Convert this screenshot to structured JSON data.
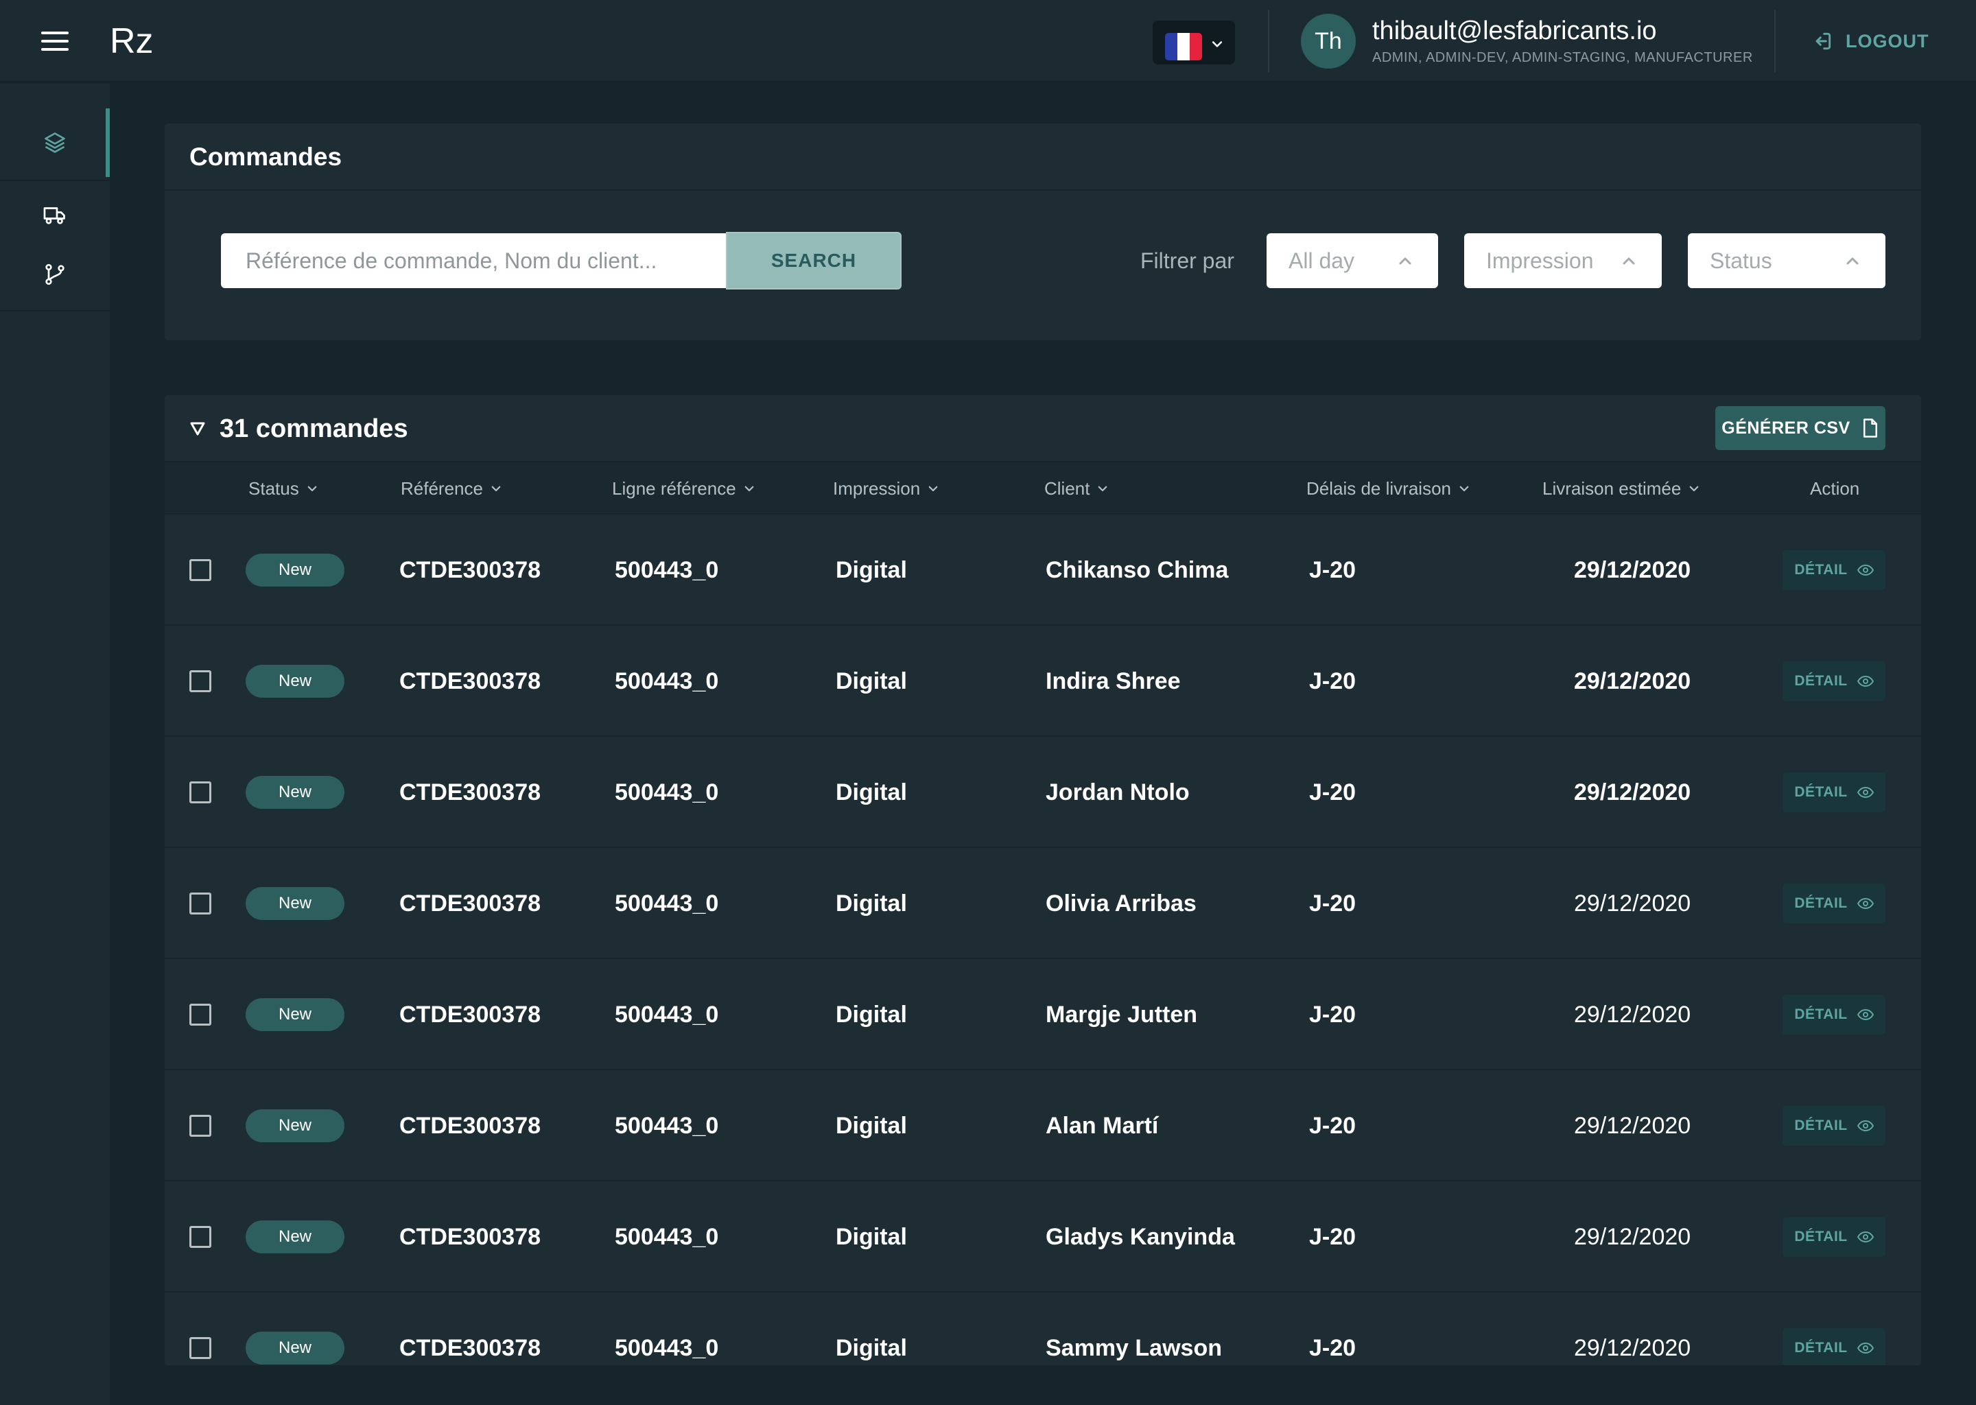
{
  "app": {
    "logo": "Rz"
  },
  "topbar": {
    "menu_icon": "hamburger-icon",
    "language": {
      "flag": "france-flag-icon",
      "chevron": "chevron-down-icon"
    },
    "user": {
      "initials": "Th",
      "email": "thibault@lesfabricants.io",
      "roles": "ADMIN, ADMIN-DEV, ADMIN-STAGING, MANUFACTURER"
    },
    "logout_label": "LOGOUT"
  },
  "sidebar": {
    "items": [
      {
        "icon": "layers-icon",
        "active": true
      },
      {
        "icon": "truck-icon",
        "active": false
      },
      {
        "icon": "git-branch-icon",
        "active": false
      }
    ]
  },
  "commandes": {
    "title": "Commandes",
    "search_placeholder": "Référence de commande, Nom du client...",
    "search_label": "SEARCH",
    "filter_label": "Filtrer par",
    "filters": [
      "All day",
      "Impression",
      "Status"
    ]
  },
  "list": {
    "count_label": "31 commandes",
    "csv_label": "GÉNÉRER CSV",
    "columns": {
      "status": "Status",
      "reference": "Référence",
      "line_reference": "Ligne référence",
      "impression": "Impression",
      "client": "Client",
      "delay": "Délais de livraison",
      "estimated": "Livraison estimée",
      "action": "Action"
    },
    "detail_label": "DÉTAIL",
    "rows": [
      {
        "status": "New",
        "reference": "CTDE300378",
        "line_reference": "500443_0",
        "impression": "Digital",
        "client": "Chikanso Chima",
        "delay": "J-20",
        "estimated": "29/12/2020",
        "estimated_bold": true
      },
      {
        "status": "New",
        "reference": "CTDE300378",
        "line_reference": "500443_0",
        "impression": "Digital",
        "client": "Indira Shree",
        "delay": "J-20",
        "estimated": "29/12/2020",
        "estimated_bold": true
      },
      {
        "status": "New",
        "reference": "CTDE300378",
        "line_reference": "500443_0",
        "impression": "Digital",
        "client": "Jordan Ntolo",
        "delay": "J-20",
        "estimated": "29/12/2020",
        "estimated_bold": true
      },
      {
        "status": "New",
        "reference": "CTDE300378",
        "line_reference": "500443_0",
        "impression": "Digital",
        "client": "Olivia Arribas",
        "delay": "J-20",
        "estimated": "29/12/2020",
        "estimated_bold": false
      },
      {
        "status": "New",
        "reference": "CTDE300378",
        "line_reference": "500443_0",
        "impression": "Digital",
        "client": "Margje Jutten",
        "delay": "J-20",
        "estimated": "29/12/2020",
        "estimated_bold": false
      },
      {
        "status": "New",
        "reference": "CTDE300378",
        "line_reference": "500443_0",
        "impression": "Digital",
        "client": "Alan Martí",
        "delay": "J-20",
        "estimated": "29/12/2020",
        "estimated_bold": false
      },
      {
        "status": "New",
        "reference": "CTDE300378",
        "line_reference": "500443_0",
        "impression": "Digital",
        "client": "Gladys Kanyinda",
        "delay": "J-20",
        "estimated": "29/12/2020",
        "estimated_bold": false
      },
      {
        "status": "New",
        "reference": "CTDE300378",
        "line_reference": "500443_0",
        "impression": "Digital",
        "client": "Sammy Lawson",
        "delay": "J-20",
        "estimated": "29/12/2020",
        "estimated_bold": false
      }
    ]
  },
  "colors": {
    "background": "#16252b",
    "panel": "#1e2c33",
    "accent": "#2c5f5d",
    "accent_text": "#5fa5a2",
    "search_button": "#95bbb8"
  }
}
